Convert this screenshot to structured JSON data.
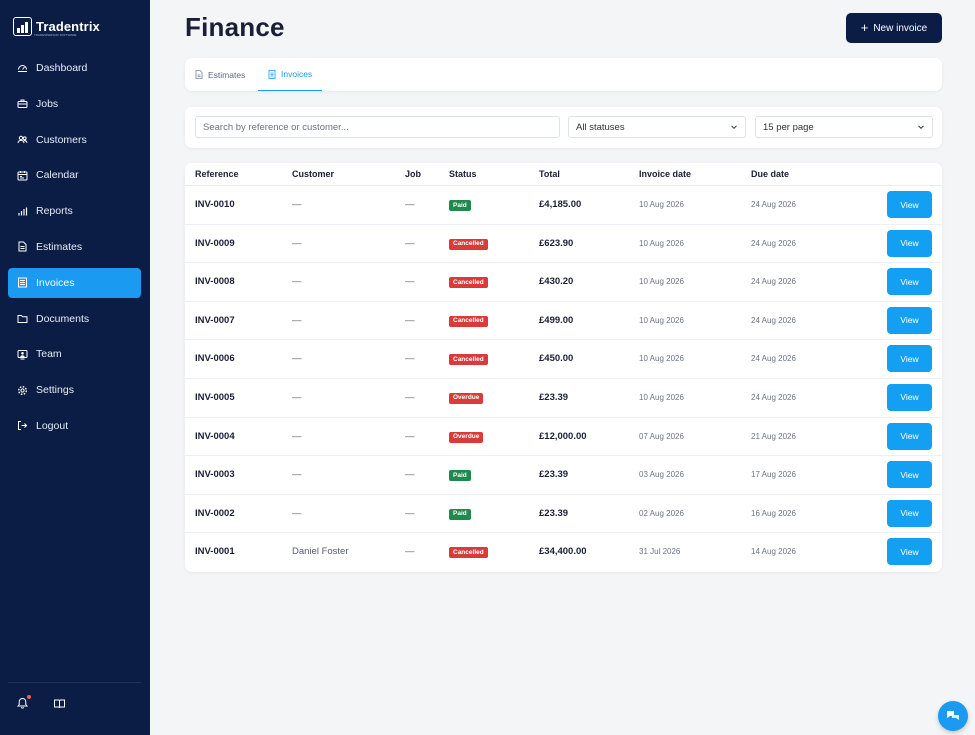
{
  "brand": {
    "name": "Tradentrix",
    "tagline": "TRADESPERSON SOFTWARE"
  },
  "sidebar": {
    "items": [
      {
        "label": "Dashboard",
        "icon": "dashboard-icon",
        "active": false
      },
      {
        "label": "Jobs",
        "icon": "briefcase-icon",
        "active": false
      },
      {
        "label": "Customers",
        "icon": "users-icon",
        "active": false
      },
      {
        "label": "Calendar",
        "icon": "calendar-icon",
        "active": false
      },
      {
        "label": "Reports",
        "icon": "bar-chart-icon",
        "active": false
      },
      {
        "label": "Estimates",
        "icon": "document-icon",
        "active": false
      },
      {
        "label": "Invoices",
        "icon": "invoice-icon",
        "active": true
      },
      {
        "label": "Documents",
        "icon": "folder-icon",
        "active": false
      },
      {
        "label": "Team",
        "icon": "team-icon",
        "active": false
      },
      {
        "label": "Settings",
        "icon": "gear-icon",
        "active": false
      },
      {
        "label": "Logout",
        "icon": "logout-icon",
        "active": false
      }
    ]
  },
  "header": {
    "title": "Finance",
    "new_button": "New invoice"
  },
  "tabs": [
    {
      "label": "Estimates",
      "active": false
    },
    {
      "label": "Invoices",
      "active": true
    }
  ],
  "filters": {
    "search_placeholder": "Search by reference or customer...",
    "status_value": "All statuses",
    "per_page_value": "15 per page"
  },
  "table": {
    "columns": [
      "Reference",
      "Customer",
      "Job",
      "Status",
      "Total",
      "Invoice date",
      "Due date"
    ],
    "view_label": "View",
    "rows": [
      {
        "ref": "INV-0010",
        "customer": "—",
        "job": "—",
        "status": "Paid",
        "total": "£4,185.00",
        "invoice_date": "10 Aug 2026",
        "due_date": "24 Aug 2026"
      },
      {
        "ref": "INV-0009",
        "customer": "—",
        "job": "—",
        "status": "Cancelled",
        "total": "£623.90",
        "invoice_date": "10 Aug 2026",
        "due_date": "24 Aug 2026"
      },
      {
        "ref": "INV-0008",
        "customer": "—",
        "job": "—",
        "status": "Cancelled",
        "total": "£430.20",
        "invoice_date": "10 Aug 2026",
        "due_date": "24 Aug 2026"
      },
      {
        "ref": "INV-0007",
        "customer": "—",
        "job": "—",
        "status": "Cancelled",
        "total": "£499.00",
        "invoice_date": "10 Aug 2026",
        "due_date": "24 Aug 2026"
      },
      {
        "ref": "INV-0006",
        "customer": "—",
        "job": "—",
        "status": "Cancelled",
        "total": "£450.00",
        "invoice_date": "10 Aug 2026",
        "due_date": "24 Aug 2026"
      },
      {
        "ref": "INV-0005",
        "customer": "—",
        "job": "—",
        "status": "Overdue",
        "total": "£23.39",
        "invoice_date": "10 Aug 2026",
        "due_date": "24 Aug 2026"
      },
      {
        "ref": "INV-0004",
        "customer": "—",
        "job": "—",
        "status": "Overdue",
        "total": "£12,000.00",
        "invoice_date": "07 Aug 2026",
        "due_date": "21 Aug 2026"
      },
      {
        "ref": "INV-0003",
        "customer": "—",
        "job": "—",
        "status": "Paid",
        "total": "£23.39",
        "invoice_date": "03 Aug 2026",
        "due_date": "17 Aug 2026"
      },
      {
        "ref": "INV-0002",
        "customer": "—",
        "job": "—",
        "status": "Paid",
        "total": "£23.39",
        "invoice_date": "02 Aug 2026",
        "due_date": "16 Aug 2026"
      },
      {
        "ref": "INV-0001",
        "customer": "Daniel Foster",
        "job": "—",
        "status": "Cancelled",
        "total": "£34,400.00",
        "invoice_date": "31 Jul 2026",
        "due_date": "14 Aug 2026"
      }
    ]
  },
  "colors": {
    "sidebar_bg": "#0b1d45",
    "accent": "#1a9af0",
    "paid": "#1f8a4c",
    "cancelled": "#d93a3a",
    "overdue": "#d93a3a"
  },
  "footer_icons": [
    "bell-icon",
    "book-icon"
  ],
  "notification_dot": true,
  "chat_icon": "chat-icon"
}
